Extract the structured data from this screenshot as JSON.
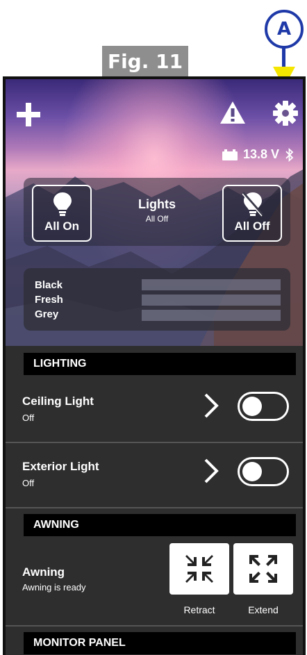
{
  "figure": {
    "label": "Fig. 11",
    "callout": "A"
  },
  "header": {
    "voltage": "13.8 V",
    "icons": [
      "plus-icon",
      "warning-icon",
      "gear-icon",
      "battery-icon",
      "bluetooth-icon"
    ]
  },
  "lights_panel": {
    "title": "Lights",
    "status": "All Off",
    "all_on_label": "All On",
    "all_off_label": "All Off"
  },
  "tanks": {
    "items": [
      {
        "label": "Black",
        "level": 0
      },
      {
        "label": "Fresh",
        "level": 0
      },
      {
        "label": "Grey",
        "level": 0
      }
    ]
  },
  "lighting": {
    "header": "LIGHTING",
    "items": [
      {
        "title": "Ceiling Light",
        "status": "Off",
        "toggle_on": false
      },
      {
        "title": "Exterior Light",
        "status": "Off",
        "toggle_on": false
      }
    ]
  },
  "awning": {
    "header": "AWNING",
    "title": "Awning",
    "status": "Awning is ready",
    "retract_label": "Retract",
    "extend_label": "Extend"
  },
  "monitor_panel": {
    "header": "MONITOR PANEL"
  },
  "colors": {
    "callout_blue": "#1f3aa8",
    "arrow_yellow": "#f5e600",
    "fig_grey": "#8e8e8e",
    "panel_bg": "#2e2e2e"
  }
}
